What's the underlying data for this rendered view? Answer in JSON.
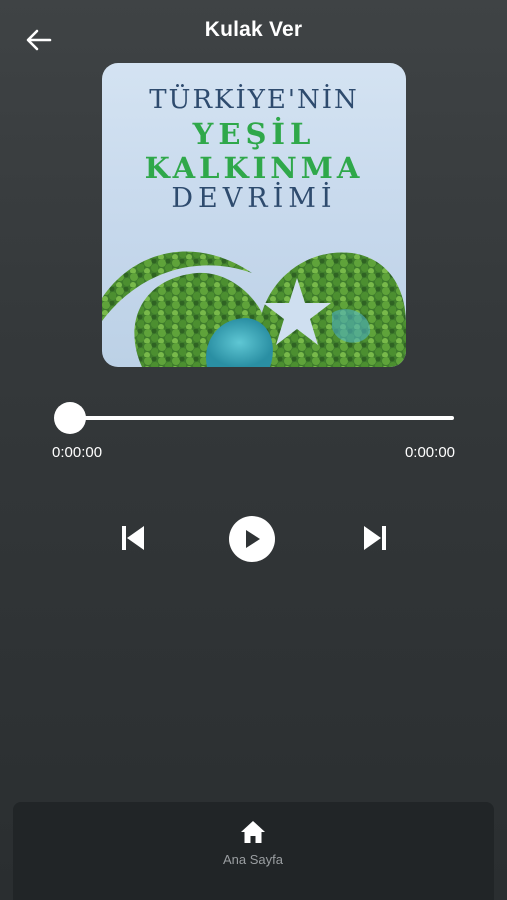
{
  "header": {
    "title": "Kulak Ver",
    "back_icon": "arrow-left-icon"
  },
  "cover": {
    "line1": "TÜRKİYE'NİN",
    "line2": "YEŞİL",
    "line3": "KALKINMA",
    "line4": "DEVRİMİ"
  },
  "player": {
    "current_time": "0:00:00",
    "total_time": "0:00:00",
    "progress": 0,
    "prev_icon": "skip-previous-icon",
    "play_icon": "play-icon",
    "next_icon": "skip-next-icon"
  },
  "bottom_nav": {
    "items": [
      {
        "label": "Ana Sayfa",
        "icon": "home-icon"
      }
    ]
  },
  "colors": {
    "background": "#35393b",
    "nav_background": "#212527",
    "accent_green": "#2fa84a",
    "title_blue": "#2e4b6e"
  }
}
